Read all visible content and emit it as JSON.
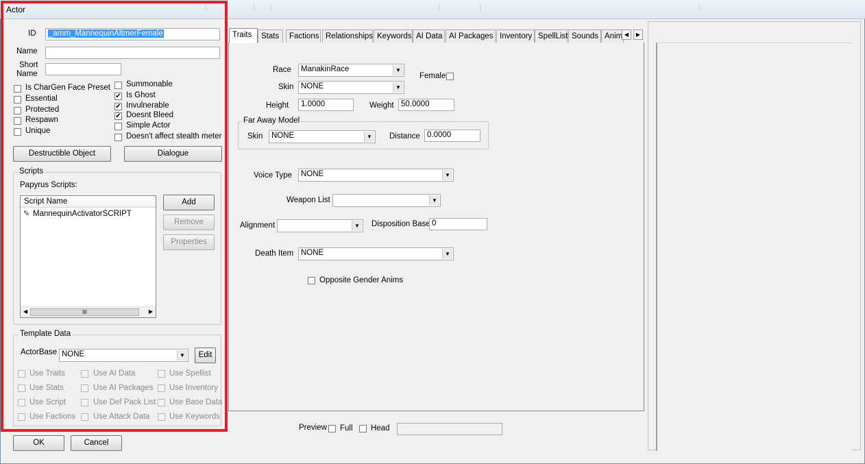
{
  "window": {
    "title": "Actor"
  },
  "identity": {
    "id_label": "ID",
    "id_value": "_amm_MannequinAltmerFemale",
    "name_label": "Name",
    "name_value": "",
    "short_name_label_1": "Short",
    "short_name_label_2": "Name",
    "short_name_value": ""
  },
  "flags_left": [
    {
      "label": "Is CharGen Face Preset",
      "checked": false
    },
    {
      "label": "Essential",
      "checked": false
    },
    {
      "label": "Protected",
      "checked": false
    },
    {
      "label": "Respawn",
      "checked": false
    },
    {
      "label": "Unique",
      "checked": false
    }
  ],
  "flags_right": [
    {
      "label": "Summonable",
      "checked": false
    },
    {
      "label": "Is Ghost",
      "checked": true
    },
    {
      "label": "Invulnerable",
      "checked": true
    },
    {
      "label": "Doesnt Bleed",
      "checked": true
    },
    {
      "label": "Simple Actor",
      "checked": false
    },
    {
      "label": "Doesn't affect stealth meter",
      "checked": false
    }
  ],
  "buttons": {
    "destructible": "Destructible Object",
    "dialogue": "Dialogue",
    "add": "Add",
    "remove": "Remove",
    "properties": "Properties",
    "edit": "Edit",
    "ok": "OK",
    "cancel": "Cancel"
  },
  "scripts": {
    "group_title": "Scripts",
    "papyrus_label": "Papyrus Scripts:",
    "column_header": "Script Name",
    "items": [
      "MannequinActivatorSCRIPT"
    ],
    "scroll_grip": "III"
  },
  "template": {
    "group_title": "Template Data",
    "actorbase_label": "ActorBase",
    "actorbase_value": "NONE",
    "flags": [
      [
        "Use Traits",
        "Use AI Data",
        "Use Spellist"
      ],
      [
        "Use Stats",
        "Use AI Packages",
        "Use Inventory"
      ],
      [
        "Use Script",
        "Use Def Pack List",
        "Use Base Data"
      ],
      [
        "Use Factions",
        "Use Attack Data",
        "Use Keywords"
      ]
    ]
  },
  "tabs": [
    "Traits",
    "Stats",
    "Factions",
    "Relationships",
    "Keywords",
    "AI Data",
    "AI Packages",
    "Inventory",
    "SpellList",
    "Sounds",
    "Anim"
  ],
  "active_tab": "Traits",
  "traits": {
    "race_label": "Race",
    "race_value": "ManakinRace",
    "female_label": "Female",
    "female_checked": false,
    "skin_label": "Skin",
    "skin_value": "NONE",
    "height_label": "Height",
    "height_value": "1.0000",
    "weight_label": "Weight",
    "weight_value": "50.0000",
    "far_away_title": "Far Away Model",
    "far_skin_label": "Skin",
    "far_skin_value": "NONE",
    "distance_label": "Distance",
    "distance_value": "0.0000",
    "voice_label": "Voice Type",
    "voice_value": "NONE",
    "weapon_list_label": "Weapon List",
    "weapon_list_value": "",
    "alignment_label": "Alignment",
    "alignment_value": "",
    "disposition_label": "Disposition Base",
    "disposition_value": "0",
    "death_item_label": "Death Item",
    "death_item_value": "NONE",
    "opposite_gender_label": "Opposite Gender Anims",
    "opposite_gender_checked": false
  },
  "preview": {
    "label": "Preview",
    "full_label": "Full",
    "head_label": "Head",
    "value": ""
  }
}
